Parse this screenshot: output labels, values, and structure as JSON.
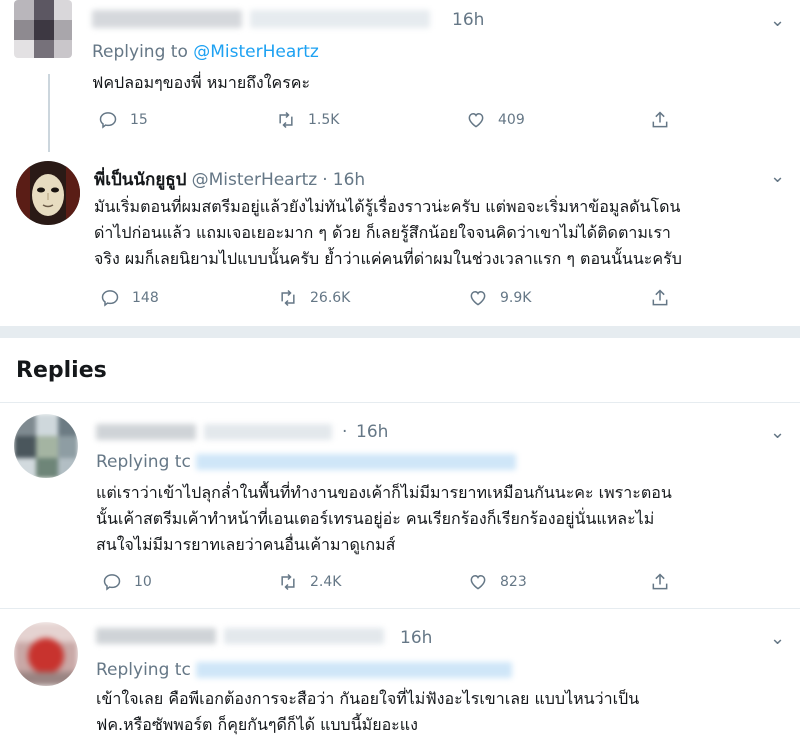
{
  "tweet1": {
    "time": "16h",
    "replying_prefix": "Replying to ",
    "replying_handle": "@MisterHeartz",
    "text": "ฟคปลอมๆของพี่ หมายถึงใครคะ",
    "replies": "15",
    "retweets": "1.5K",
    "likes": "409"
  },
  "tweet2": {
    "name": "พี่เป็นนักยูธูป",
    "handle": "@MisterHeartz",
    "sep": "·",
    "time": "16h",
    "lines": [
      "มันเริ่มตอนที่ผมสตรีมอยู่แล้วยังไม่ทันได้รู้เรื่องราวน่ะครับ แต่พอจะเริ่มหาข้อมูลดันโดน",
      "ด่าไปก่อนแล้ว แถมเจอเยอะมาก ๆ ด้วย ก็เลยรู้สึกน้อยใจจนคิดว่าเขาไม่ได้ติดตามเรา",
      "จริง ผมก็เลยนิยามไปแบบนั้นครับ ย้ำว่าแค่คนที่ด่าผมในช่วงเวลาแรก ๆ ตอนนั้นนะครับ"
    ],
    "replies": "148",
    "retweets": "26.6K",
    "likes": "9.9K"
  },
  "section_title": "Replies",
  "reply1": {
    "sep": "·",
    "time": "16h",
    "replying_prefix": "Replying tc",
    "lines": [
      "แต่เราว่าเข้าไปลุกล่ำในพื้นที่ทำงานของเค้าก็ไม่มีมารยาทเหมือนกันนะคะ เพราะตอน",
      "นั้นเค้าสตรีมเค้าทำหน้าที่เอนเตอร์เทรนอยู่อ่ะ คนเรียกร้องก็เรียกร้องอยู่นั่นแหละไม่",
      "สนใจไม่มีมารยาทเลยว่าคนอื่นเค้ามาดูเกมส์"
    ],
    "replies": "10",
    "retweets": "2.4K",
    "likes": "823"
  },
  "reply2": {
    "time": "16h",
    "replying_prefix": "Replying tc",
    "lines": [
      "เข้าใจเลย คือพีเอกต้องการจะสือว่า กันอยใจที่ไม่ฟังอะไรเขาเลย แบบไหนว่าเป็น",
      "ฟค.หรือซัพพอร์ต ก็คุยกันๆดีก็ได้ แบบนี้มัยอะแง"
    ]
  },
  "icons": {
    "reply": "reply-icon",
    "retweet": "retweet-icon",
    "like": "heart-icon",
    "share": "share-icon",
    "caret": "chevron-down-icon"
  }
}
